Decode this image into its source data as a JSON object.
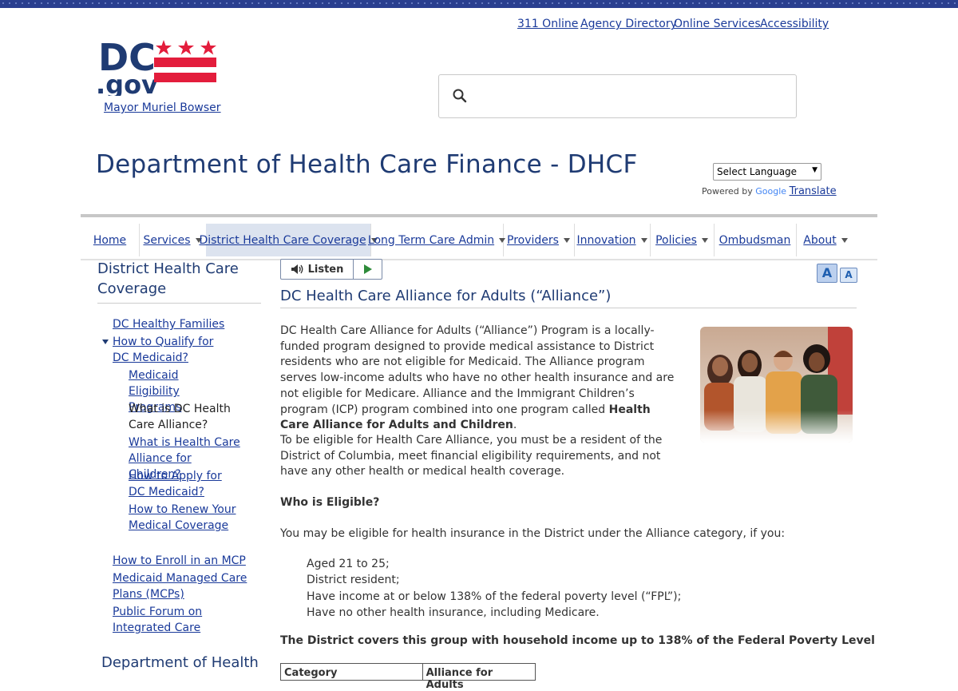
{
  "utility_nav": [
    "311 Online",
    "Agency Directory",
    "Online Services",
    "Accessibility"
  ],
  "logo": {
    "text_dc": "DC",
    "text_gov": ".gov"
  },
  "mayor_link": "Mayor Muriel Bowser",
  "search": {
    "placeholder": "",
    "icon": "search-icon"
  },
  "agency_title": "Department of Health Care Finance - DHCF",
  "translate": {
    "select_label": "Select Language",
    "powered_by": "Powered by",
    "google": "Google",
    "translate_link": "Translate"
  },
  "main_nav": [
    {
      "label": "Home",
      "dropdown": false
    },
    {
      "label": "Services",
      "dropdown": true
    },
    {
      "label": "District Health Care Coverage",
      "dropdown": true,
      "active": true
    },
    {
      "label": "Long Term Care Admin",
      "dropdown": true
    },
    {
      "label": "Providers",
      "dropdown": true
    },
    {
      "label": "Innovation",
      "dropdown": true
    },
    {
      "label": "Policies",
      "dropdown": true
    },
    {
      "label": "Ombudsman",
      "dropdown": false
    },
    {
      "label": "About",
      "dropdown": true
    }
  ],
  "sidebar": {
    "heading": "District Health Care Coverage",
    "items": [
      "DC Healthy Families",
      "How to Qualify for DC Medicaid?",
      "Medicaid Eligibility Programs",
      "What is DC Health Care Alliance?",
      "What is Health Care Alliance for Children?",
      "How to Apply for DC Medicaid?",
      "How to Renew Your Medical Coverage",
      "How to Enroll in an MCP",
      "Medicaid Managed Care Plans (MCPs)",
      "Public Forum on Integrated Care"
    ],
    "footer_heading": "Department of Health"
  },
  "listen_button": "Listen",
  "font_controls": {
    "larger": "A",
    "smaller": "A"
  },
  "page": {
    "heading": "DC Health Care Alliance for Adults (“Alliance”)",
    "intro_1": "DC Health Care Alliance for Adults (“Alliance”) Program is a locally-funded program designed to provide medical assistance to District residents who are not eligible for Medicaid. The Alliance program serves low-income adults who have no other health insurance and are not eligible for Medicare.  Alliance and the Immigrant Children’s program (ICP) program combined into one program called ",
    "intro_bold": "Health Care Alliance for Adults and Children",
    "intro_end": ".",
    "para_2": "To be eligible for Health Care Alliance, you must be a resident of the District of Columbia, meet financial eligibility requirements, and not have any other health or medical health coverage.",
    "who_heading": "Who is Eligible?",
    "eligible_intro": "You may be eligible for health insurance in the District under the Alliance category, if you:",
    "criteria": [
      "Aged 21 to 25;",
      "District resident;",
      "Have income at or below 138% of the federal poverty level (“FPL”);",
      "Have no other health insurance, including Medicare."
    ],
    "covers_text": "The District covers this group with household income up to 138% of the Federal Poverty Level",
    "table_headers": [
      "Category",
      "Alliance for Adults"
    ]
  },
  "colors": {
    "brand_blue": "#1f3b73",
    "link": "#1a3a9a",
    "flag_red": "#e31d3c",
    "active_tab": "#dce3ef"
  }
}
